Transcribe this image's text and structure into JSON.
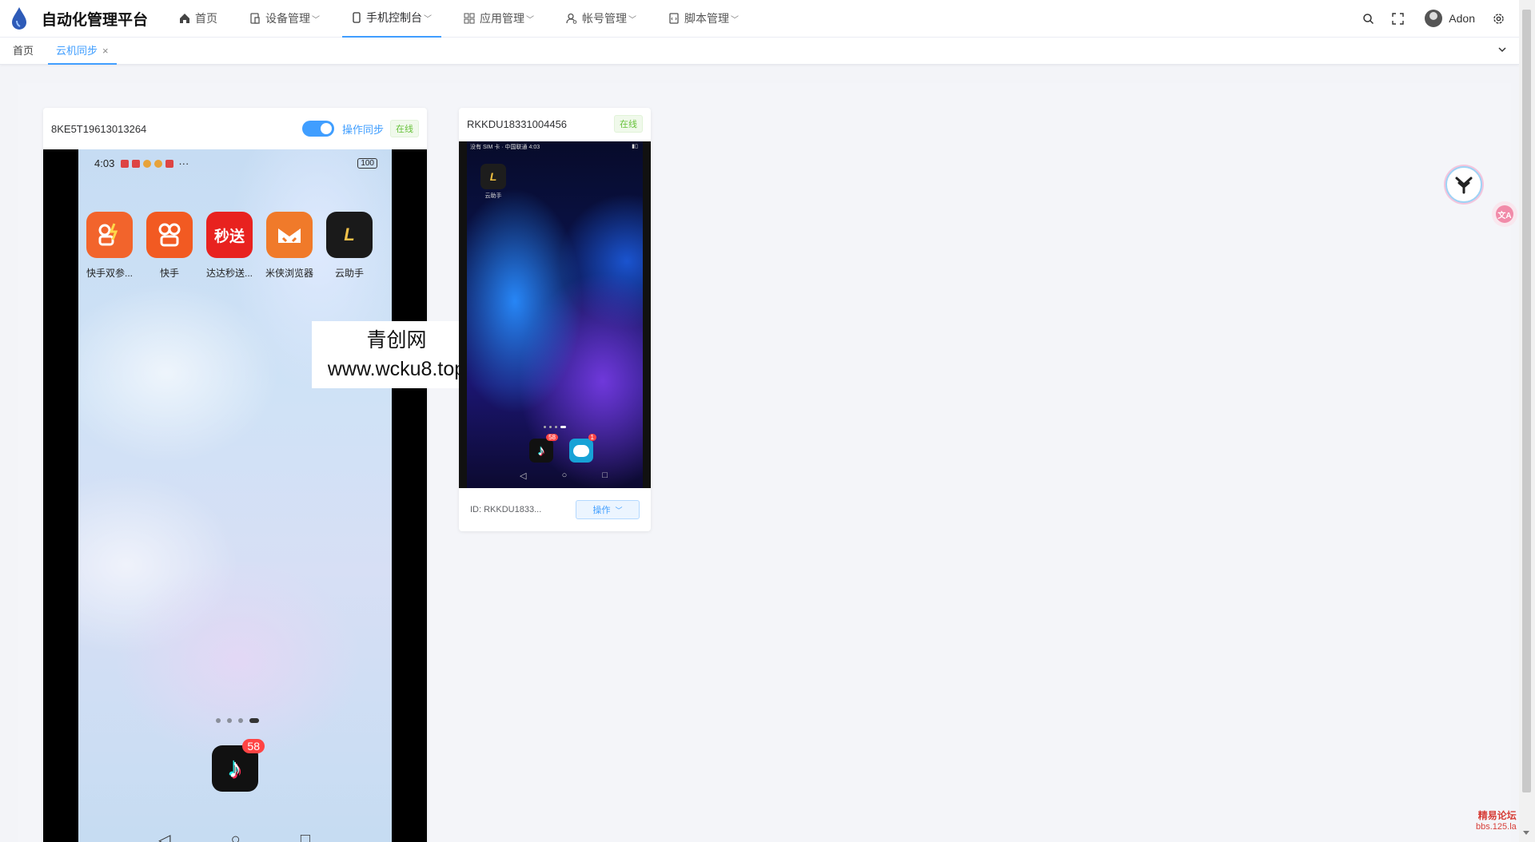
{
  "app": {
    "title": "自动化管理平台"
  },
  "nav": {
    "items": [
      {
        "label": "首页",
        "icon": "home-icon",
        "has_dropdown": false
      },
      {
        "label": "设备管理",
        "icon": "device-icon",
        "has_dropdown": true
      },
      {
        "label": "手机控制台",
        "icon": "phone-icon",
        "has_dropdown": true,
        "active": true
      },
      {
        "label": "应用管理",
        "icon": "apps-icon",
        "has_dropdown": true
      },
      {
        "label": "帐号管理",
        "icon": "account-icon",
        "has_dropdown": true
      },
      {
        "label": "脚本管理",
        "icon": "script-icon",
        "has_dropdown": true
      }
    ],
    "username": "Adon"
  },
  "tags": {
    "home": "首页",
    "active": "云机同步",
    "close": "×"
  },
  "device1": {
    "id": "8KE5T19613013264",
    "sync_label": "操作同步",
    "sync_on": true,
    "status": "在线",
    "phone": {
      "time": "4:03",
      "battery": "100",
      "apps": [
        {
          "name": "快手双参...",
          "icon_text": "",
          "color": "#f2642c"
        },
        {
          "name": "快手",
          "icon_text": "",
          "color": "#f25a22"
        },
        {
          "name": "达达秒送...",
          "icon_text": "秒送",
          "color": "#e8221f"
        },
        {
          "name": "米侠浏览器",
          "icon_text": "",
          "color": "#f07a2a"
        },
        {
          "name": "云助手",
          "icon_text": "L",
          "color": "#1a1a1a"
        }
      ],
      "dock_badge": "58"
    }
  },
  "watermark": {
    "line1": "青创网",
    "line2": "www.wcku8.top"
  },
  "device2": {
    "id": "RKKDU18331004456",
    "status": "在线",
    "phone": {
      "status_left": "没有 SIM 卡 · 中国联通 4:03",
      "app_name": "云助手",
      "tiktok_badge": "58",
      "msg_badge": "1"
    },
    "footer_id": "ID: RKKDU1833...",
    "op_label": "操作"
  },
  "corner": {
    "line1": "精易论坛",
    "line2": "bbs.125.la"
  },
  "colors": {
    "accent": "#409eff",
    "online": "#67c23a"
  }
}
